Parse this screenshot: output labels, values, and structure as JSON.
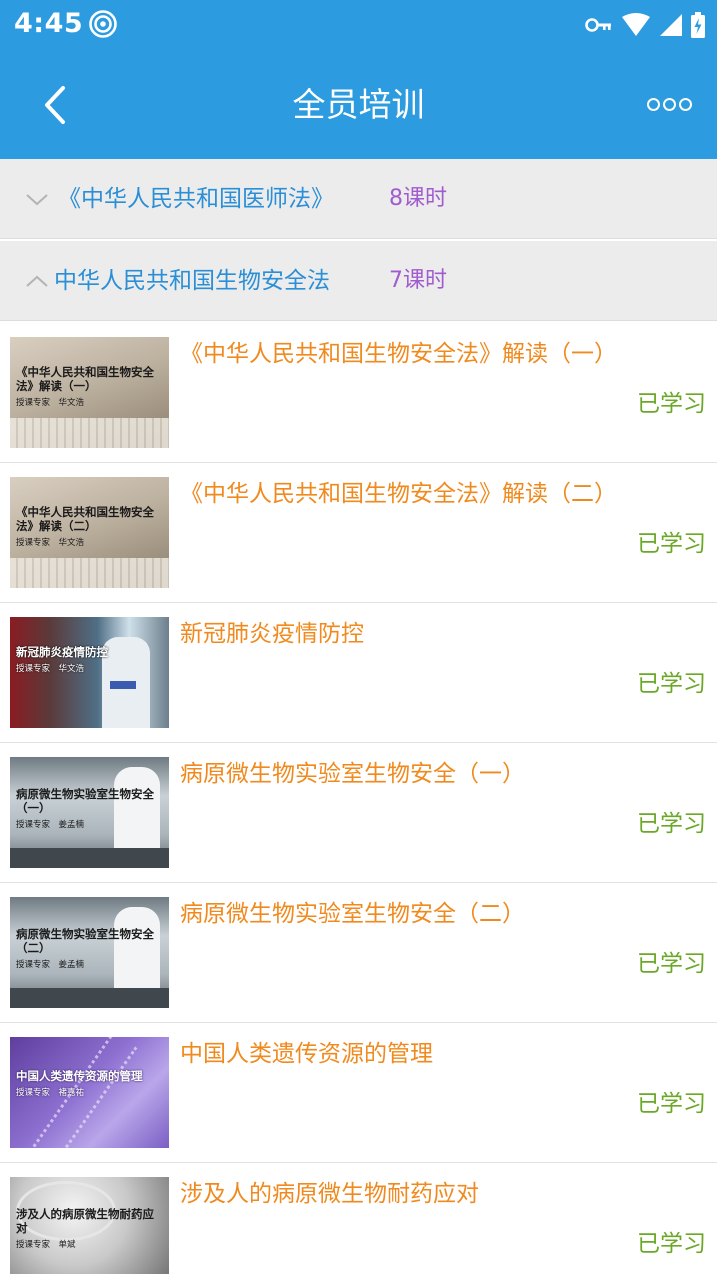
{
  "status_bar": {
    "time": "4:45",
    "icons": [
      "hotspot-icon",
      "vpn-key-icon",
      "wifi-icon",
      "signal-icon",
      "battery-charging-icon"
    ]
  },
  "colors": {
    "primary": "#2c9be0",
    "section_title": "#2a8fd6",
    "hours": "#a05ccf",
    "course_title": "#f08a1e",
    "status": "#6ca828"
  },
  "header": {
    "title": "全员培训",
    "back_icon": "chevron-left-icon",
    "more_icon": "more-dots-icon"
  },
  "sections": [
    {
      "title": "《中华人民共和国医师法》",
      "hours": "8课时",
      "expanded": false
    },
    {
      "title": "中华人民共和国生物安全法",
      "hours": "7课时",
      "expanded": true
    }
  ],
  "courses": [
    {
      "title": "《中华人民共和国生物安全法》解读（一）",
      "status": "已学习",
      "thumb_title": "《中华人民共和国生物安全法》解读（一）",
      "thumb_sub": "授课专家　华文浩",
      "thumb_style": "book"
    },
    {
      "title": "《中华人民共和国生物安全法》解读（二）",
      "status": "已学习",
      "thumb_title": "《中华人民共和国生物安全法》解读（二）",
      "thumb_sub": "授课专家　华文浩",
      "thumb_style": "book"
    },
    {
      "title": "新冠肺炎疫情防控",
      "status": "已学习",
      "thumb_title": "新冠肺炎疫情防控",
      "thumb_sub": "授课专家　华文浩",
      "thumb_style": "ppe"
    },
    {
      "title": "病原微生物实验室生物安全（一）",
      "status": "已学习",
      "thumb_title": "病原微生物实验室生物安全（一）",
      "thumb_sub": "授课专家　姜孟楠",
      "thumb_style": "lab"
    },
    {
      "title": "病原微生物实验室生物安全（二）",
      "status": "已学习",
      "thumb_title": "病原微生物实验室生物安全（二）",
      "thumb_sub": "授课专家　姜孟楠",
      "thumb_style": "lab"
    },
    {
      "title": "中国人类遗传资源的管理",
      "status": "已学习",
      "thumb_title": "中国人类遗传资源的管理",
      "thumb_sub": "授课专家　褚嘉祐",
      "thumb_style": "dna"
    },
    {
      "title": "涉及人的病原微生物耐药应对",
      "status": "已学习",
      "thumb_title": "涉及人的病原微生物耐药应对",
      "thumb_sub": "授课专家　单斌",
      "thumb_style": "petri"
    }
  ]
}
